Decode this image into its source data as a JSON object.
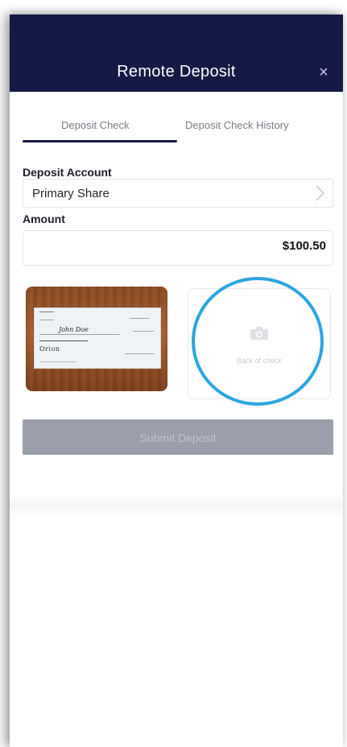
{
  "header": {
    "title": "Remote Deposit",
    "close_label": "×"
  },
  "tabs": [
    {
      "label": "Deposit Check",
      "active": true
    },
    {
      "label": "Deposit Check History",
      "active": false
    }
  ],
  "deposit_account": {
    "label": "Deposit Account",
    "value": "Primary Share"
  },
  "amount": {
    "label": "Amount",
    "value": "$100.50"
  },
  "check_front": {
    "payee": "John Doe",
    "bank": "Orion"
  },
  "check_back": {
    "placeholder_label": "Back of check"
  },
  "submit": {
    "label": "Submit Deposit"
  },
  "colors": {
    "header": "#141a45",
    "highlight": "#2ba6df",
    "submit_disabled": "#9b9fac"
  }
}
